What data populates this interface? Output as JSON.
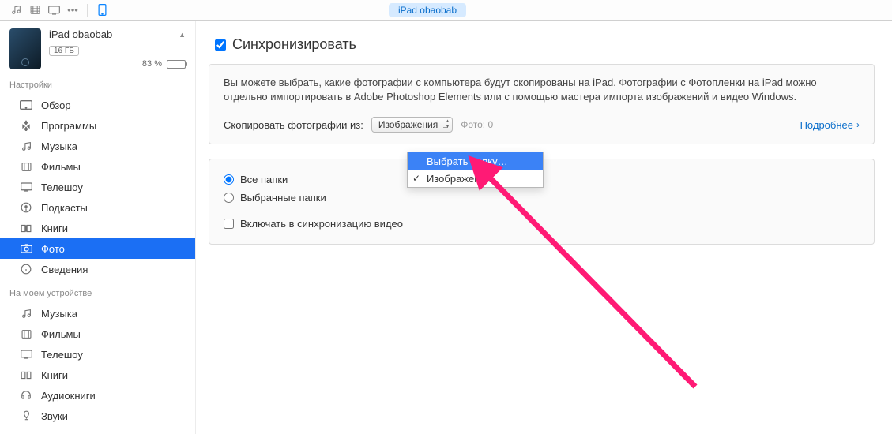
{
  "toolbar": {
    "device_pill": "iPad obaobab"
  },
  "device": {
    "name": "iPad obaobab",
    "capacity": "16 ГБ",
    "battery_pct": "83 %"
  },
  "sidebar": {
    "section_settings": "Настройки",
    "section_on_device": "На моем устройстве",
    "settings_items": [
      {
        "icon": "overview-icon",
        "label": "Обзор"
      },
      {
        "icon": "apps-icon",
        "label": "Программы"
      },
      {
        "icon": "music-icon",
        "label": "Музыка"
      },
      {
        "icon": "films-icon",
        "label": "Фильмы"
      },
      {
        "icon": "tv-icon",
        "label": "Телешоу"
      },
      {
        "icon": "podcasts-icon",
        "label": "Подкасты"
      },
      {
        "icon": "books-icon",
        "label": "Книги"
      },
      {
        "icon": "photos-icon",
        "label": "Фото",
        "selected": true
      },
      {
        "icon": "info-icon",
        "label": "Сведения"
      }
    ],
    "device_items": [
      {
        "icon": "music-icon",
        "label": "Музыка"
      },
      {
        "icon": "films-icon",
        "label": "Фильмы"
      },
      {
        "icon": "tv-icon",
        "label": "Телешоу"
      },
      {
        "icon": "books-icon",
        "label": "Книги"
      },
      {
        "icon": "audiobooks-icon",
        "label": "Аудиокниги"
      },
      {
        "icon": "sounds-icon",
        "label": "Звуки"
      }
    ]
  },
  "content": {
    "sync_label": "Синхронизировать",
    "description": "Вы можете выбрать, какие фотографии с компьютера будут скопированы на iPad. Фотографии с Фотопленки на iPad можно отдельно импортировать в Adobe Photoshop Elements или с помощью мастера импорта изображений и видео Windows.",
    "copy_from_label": "Скопировать фотографии из:",
    "source_selected": "Изображения",
    "photo_count": "Фото: 0",
    "more_link": "Подробнее",
    "radio_all": "Все папки",
    "radio_selected": "Выбранные папки",
    "include_video": "Включать в синхронизацию видео",
    "dropdown": {
      "choose_folder": "Выбрать папку…",
      "images": "Изображения"
    }
  }
}
